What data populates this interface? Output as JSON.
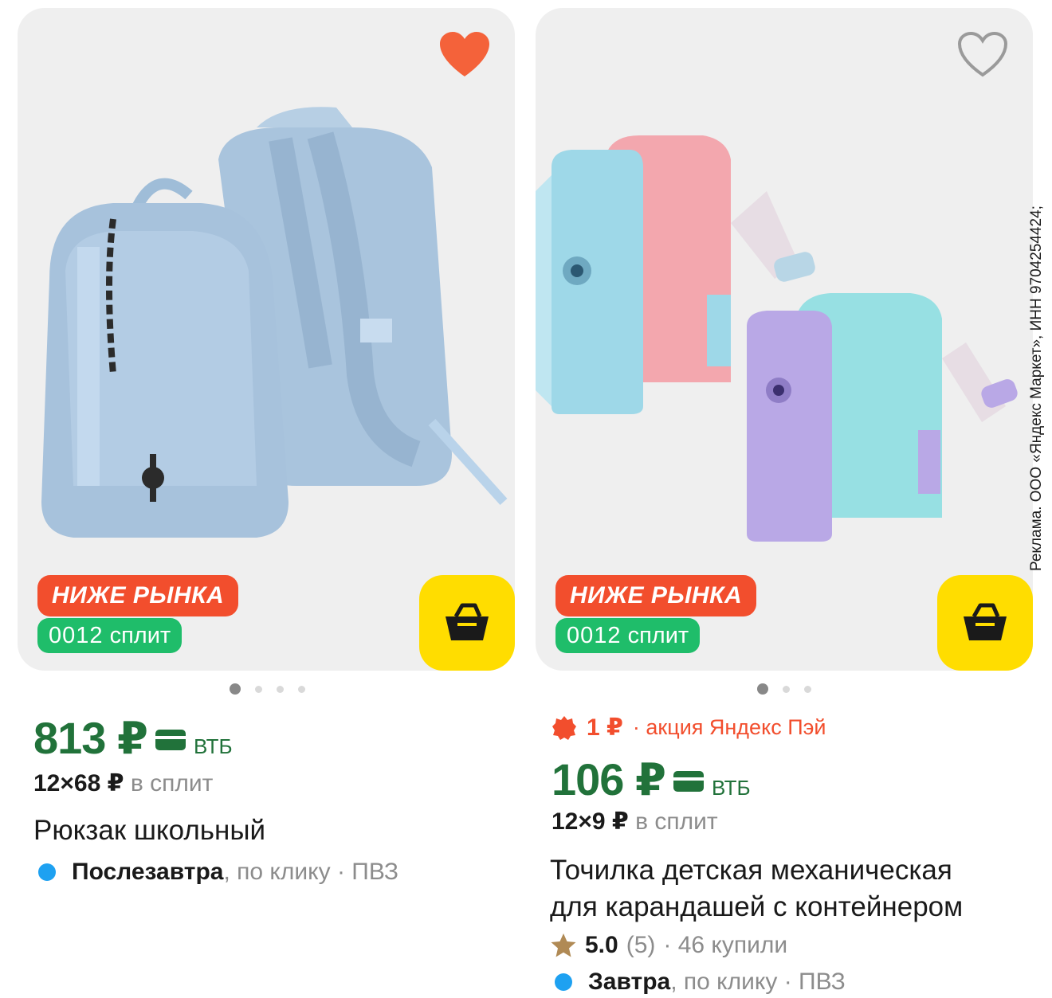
{
  "products": [
    {
      "favorite": true,
      "badge_market": "НИЖЕ РЫНКА",
      "badge_split_prefix": "0012",
      "badge_split_label": "сплит",
      "price": "813 ₽",
      "bank": "ВТБ",
      "split_main": "12×68 ₽",
      "split_suffix": "в сплит",
      "title": "Рюкзак школьный",
      "delivery_day": "Послезавтра",
      "delivery_rest": ", по клику · ПВЗ",
      "dots": 4
    },
    {
      "favorite": false,
      "badge_market": "НИЖЕ РЫНКА",
      "badge_split_prefix": "0012",
      "badge_split_label": "сплит",
      "promo_amount": "1 ₽",
      "promo_text": "· акция Яндекс Пэй",
      "price": "106 ₽",
      "bank": "ВТБ",
      "split_main": "12×9 ₽",
      "split_suffix": "в сплит",
      "title_line1": "Точилка детская механическая",
      "title_line2": "для карандашей с контейнером",
      "rating_score": "5.0",
      "rating_count": "(5)",
      "rating_bought": "· 46 купили",
      "delivery_day": "Завтра",
      "delivery_rest": ", по клику · ПВЗ",
      "dots": 3
    }
  ],
  "ad_note": "Реклама. ООО «Яндекс Маркет», ИНН 9704254424;",
  "colors": {
    "price_green": "#21723a",
    "badge_red": "#f24e2d",
    "split_green": "#1fbd6a",
    "cart_yellow": "#ffdd00",
    "delivery_blue": "#1ea1f1",
    "heart_red": "#f4623a"
  },
  "icons": [
    "heart-filled-icon",
    "heart-outline-icon",
    "cart-icon",
    "card-icon",
    "star-icon",
    "promo-burst-icon"
  ]
}
